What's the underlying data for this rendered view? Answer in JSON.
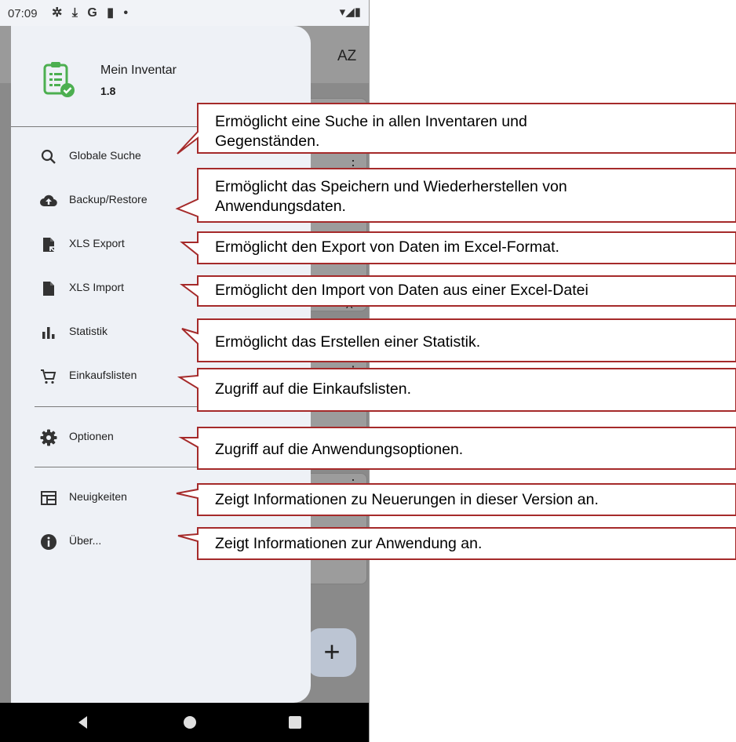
{
  "statusbar": {
    "time": "07:09",
    "left_icons": "✲ ⤓ G ▮ •",
    "right_icons": "▾◢▮"
  },
  "background": {
    "sort_icon": "AZ",
    "fab_label": "+"
  },
  "drawer": {
    "app_name": "Mein Inventar",
    "app_version": "1.8",
    "items": [
      {
        "label": "Globale Suche",
        "icon": "search-icon"
      },
      {
        "label": "Backup/Restore",
        "icon": "cloud-upload-icon"
      },
      {
        "label": "XLS Export",
        "icon": "file-export-icon"
      },
      {
        "label": "XLS Import",
        "icon": "file-icon"
      },
      {
        "label": "Statistik",
        "icon": "bar-chart-icon"
      },
      {
        "label": "Einkaufslisten",
        "icon": "cart-icon"
      },
      {
        "label": "Optionen",
        "icon": "gear-icon"
      },
      {
        "label": "Neuigkeiten",
        "icon": "news-icon"
      },
      {
        "label": "Über...",
        "icon": "info-icon"
      }
    ]
  },
  "callouts": [
    {
      "line1": "Ermöglicht eine Suche in allen Inventaren und",
      "line2": "Gegenständen."
    },
    {
      "line1": "Ermöglicht das Speichern und Wiederherstellen von",
      "line2": "Anwendungsdaten."
    },
    {
      "line1": "Ermöglicht den Export von Daten im Excel-Format."
    },
    {
      "line1": "Ermöglicht den Import von Daten aus einer Excel-Datei"
    },
    {
      "line1": "Ermöglicht das Erstellen einer Statistik."
    },
    {
      "line1": "Zugriff auf die Einkaufslisten."
    },
    {
      "line1": "Zugriff auf die Anwendungsoptionen."
    },
    {
      "line1": "Zeigt Informationen zu Neuerungen in dieser Version an."
    },
    {
      "line1": "Zeigt Informationen zur Anwendung an."
    }
  ],
  "colors": {
    "callout_border": "#a52a2a",
    "drawer_bg": "#eef1f6",
    "logo_green": "#4caf50"
  }
}
